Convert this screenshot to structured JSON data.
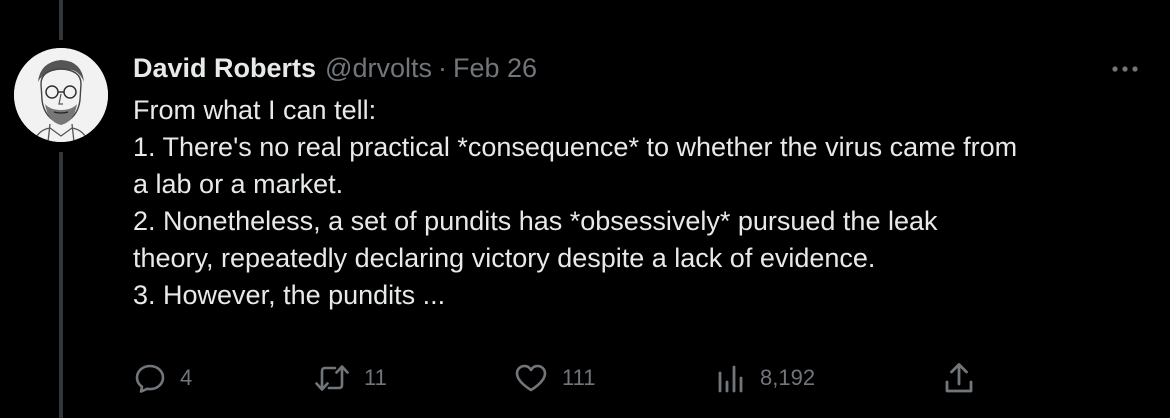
{
  "tweet": {
    "author_name": "David Roberts",
    "handle": "@drvolts",
    "separator": "·",
    "date": "Feb 26",
    "lines": [
      "From what I can tell:",
      "1. There's no real practical *consequence* to whether the virus came from",
      "a lab or a market.",
      "2. Nonetheless, a set of pundits has *obsessively* pursued the leak",
      "theory, repeatedly declaring victory despite a lack of evidence.",
      "3. However, the pundits ..."
    ]
  },
  "actions": {
    "replies": "4",
    "retweets": "11",
    "likes": "111",
    "views": "8,192"
  },
  "icons": {
    "reply": "reply-icon",
    "retweet": "retweet-icon",
    "like": "heart-icon",
    "views": "analytics-icon",
    "share": "share-icon",
    "more": "more-icon"
  },
  "colors": {
    "background": "#000000",
    "text": "#e7e9ea",
    "secondary": "#71767b",
    "thread_line": "#333639"
  }
}
